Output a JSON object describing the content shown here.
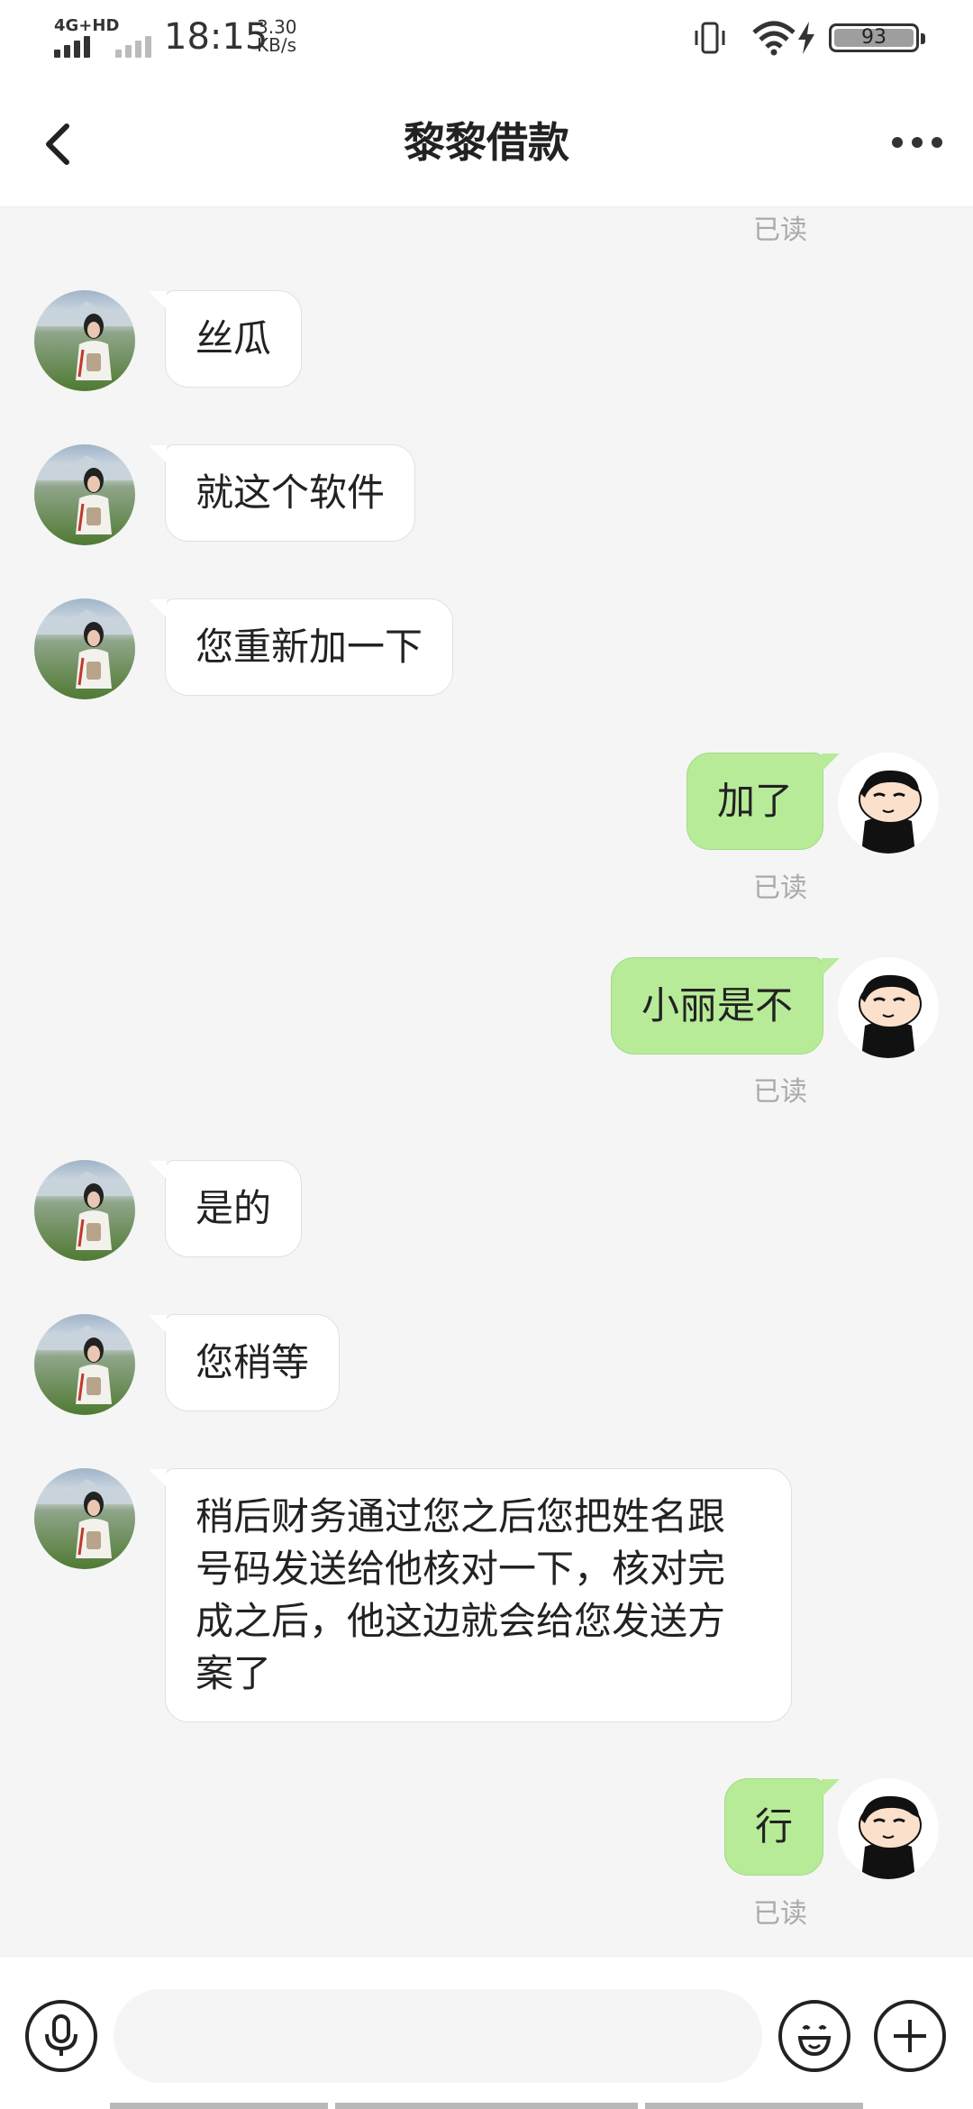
{
  "status_bar": {
    "network_label": "4G+HD",
    "time": "18:15",
    "speed_value": "3.30",
    "speed_unit": "KB/s",
    "battery": "93",
    "icons": [
      "signal-bars-icon",
      "vibrate-icon",
      "wifi-icon",
      "charging-bolt-icon",
      "battery-icon"
    ]
  },
  "header": {
    "title": "黎黎借款",
    "back_icon": "chevron-left-icon",
    "more_icon": "more-dots-icon"
  },
  "chat": {
    "top_receipt": "已读",
    "messages": [
      {
        "side": "left",
        "text": "丝瓜"
      },
      {
        "side": "left",
        "text": "就这个软件"
      },
      {
        "side": "left",
        "text": "您重新加一下"
      },
      {
        "side": "right",
        "text": "加了",
        "receipt": "已读"
      },
      {
        "side": "right",
        "text": "小丽是不",
        "receipt": "已读"
      },
      {
        "side": "left",
        "text": "是的"
      },
      {
        "side": "left",
        "text": "您稍等"
      },
      {
        "side": "left",
        "lines": [
          "稍后财务通过您之后您把姓名跟",
          "号码发送给他核对一下，核对完",
          "成之后，他这边就会给您发送方",
          "案了"
        ]
      },
      {
        "side": "right",
        "text": "行",
        "receipt": "已读"
      }
    ]
  },
  "input_bar": {
    "voice_icon": "microphone-icon",
    "input_value": "",
    "input_placeholder": "",
    "emoji_icon": "emoji-icon",
    "add_icon": "plus-icon"
  },
  "colors": {
    "sent_bubble": "#b7eb98",
    "received_bubble": "#ffffff",
    "chat_background": "#f5f5f5"
  }
}
